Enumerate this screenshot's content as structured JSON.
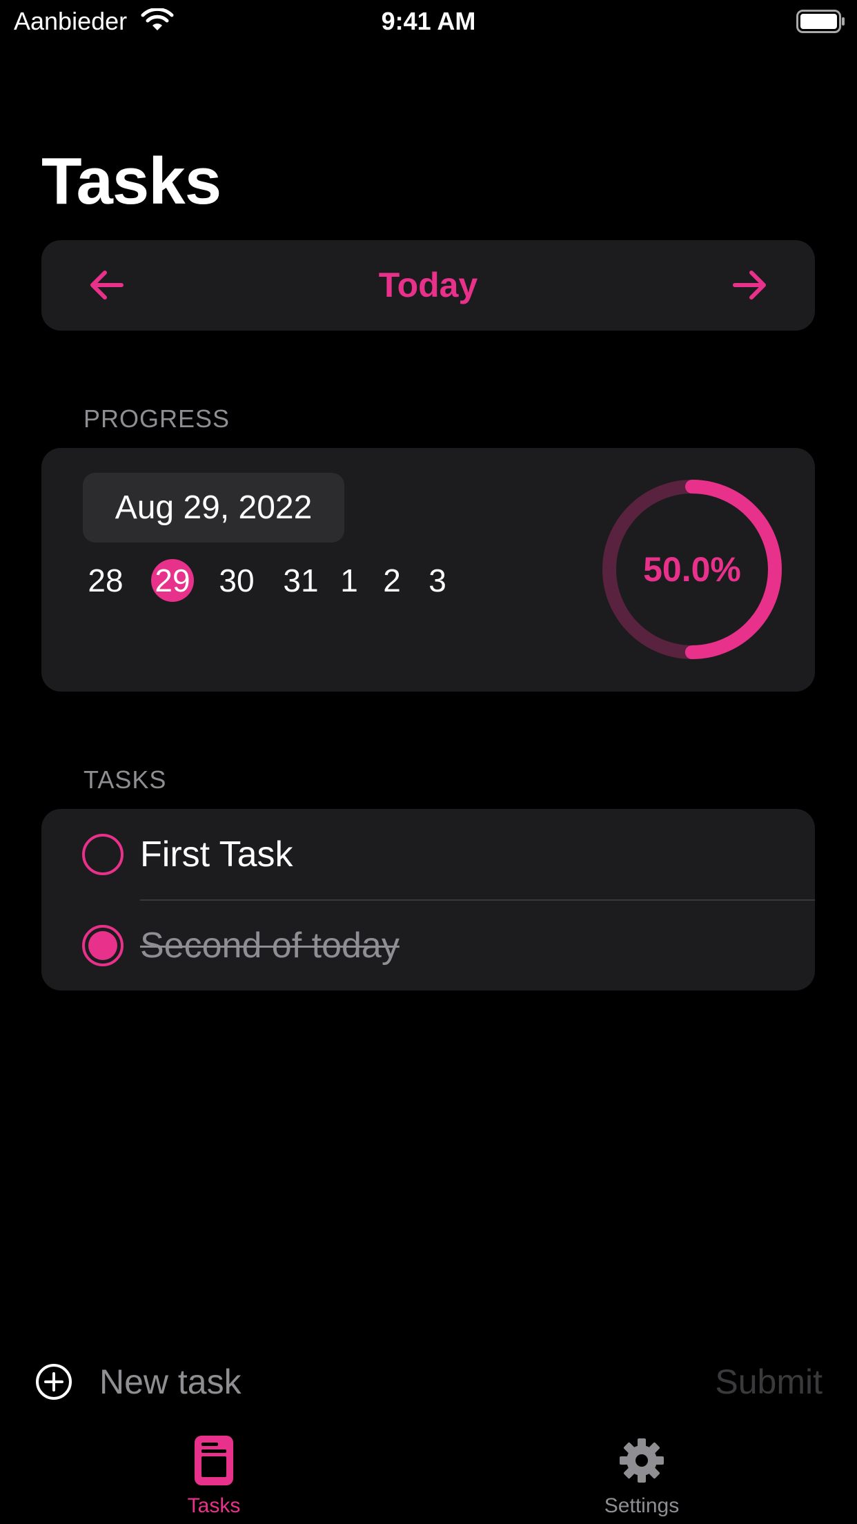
{
  "status_bar": {
    "carrier": "Aanbieder",
    "time": "9:41 AM"
  },
  "page_title": "Tasks",
  "day_nav": {
    "label": "Today",
    "prev_icon": "arrow-left-icon",
    "next_icon": "arrow-right-icon"
  },
  "progress": {
    "section_label": "PROGRESS",
    "date": "Aug 29, 2022",
    "days": [
      "28",
      "29",
      "30",
      "31",
      "1",
      "2",
      "3"
    ],
    "selected_day": "29",
    "percent_label": "50.0%",
    "fraction": 0.5
  },
  "tasks": {
    "section_label": "TASKS",
    "items": [
      {
        "title": "First Task",
        "done": false
      },
      {
        "title": "Second of today",
        "done": true
      }
    ]
  },
  "composer": {
    "placeholder": "New task",
    "submit_label": "Submit",
    "icon": "plus-circle-icon"
  },
  "tab_bar": [
    {
      "label": "Tasks",
      "icon": "book-icon",
      "selected": true
    },
    {
      "label": "Settings",
      "icon": "gear-icon",
      "selected": false
    }
  ],
  "colors": {
    "accent": "#e8318a",
    "card": "#1c1c1e",
    "secondary_text": "#8e8e93",
    "submit_disabled": "#3a3a3c"
  }
}
